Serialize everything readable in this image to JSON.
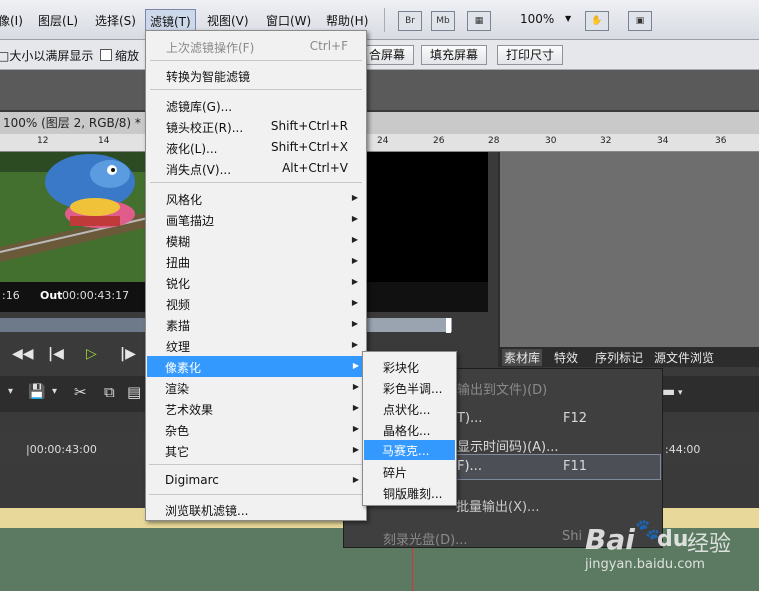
{
  "menubar": {
    "items": [
      "像(I)",
      "图层(L)",
      "选择(S)",
      "滤镜(T)",
      "视图(V)",
      "窗口(W)",
      "帮助(H)"
    ],
    "icons": [
      "Br",
      "Mb"
    ],
    "zoom": "100%"
  },
  "options": {
    "text1": "□大小以满屏显示",
    "check_label": "缩放",
    "btn_fit": "合屏幕",
    "btn_fill": "填充屏幕",
    "btn_print": "打印尺寸"
  },
  "document": {
    "tab_title": "100% (图层 2, RGB/8) *"
  },
  "ruler": {
    "ticks": [
      "12",
      "14",
      "24",
      "26",
      "28",
      "30",
      "32",
      "34",
      "36"
    ]
  },
  "monitor": {
    "tc_left": ":16",
    "out_label": "Out",
    "out_time": "00:00:43:17"
  },
  "panel": {
    "tabs": [
      "素材库",
      "特效",
      "序列标记",
      "源文件浏览"
    ]
  },
  "timeline": {
    "tc1": "|00:00:43:00",
    "tc2": ":44:00"
  },
  "filter_menu": {
    "last_filter": "上次滤镜操作(F)",
    "last_filter_sc": "Ctrl+F",
    "smart": "转换为智能滤镜",
    "gallery": "滤镜库(G)...",
    "lens": "镜头校正(R)...",
    "lens_sc": "Shift+Ctrl+R",
    "liquify": "液化(L)...",
    "liquify_sc": "Shift+Ctrl+X",
    "vanishing": "消失点(V)...",
    "vanishing_sc": "Alt+Ctrl+V",
    "groups": [
      "风格化",
      "画笔描边",
      "模糊",
      "扭曲",
      "锐化",
      "视频",
      "素描",
      "纹理",
      "像素化",
      "渲染",
      "艺术效果",
      "杂色",
      "其它"
    ],
    "digimarc": "Digimarc",
    "browse": "浏览联机滤镜..."
  },
  "pixelate_submenu": {
    "items": [
      "彩块化",
      "彩色半调...",
      "点状化...",
      "晶格化...",
      "马赛克...",
      "碎片",
      "铜版雕刻..."
    ],
    "highlighted": "马赛克..."
  },
  "export_menu": {
    "item1": "输出到文件)(D)",
    "item2": "T)...",
    "item2_sc": "F12",
    "item3": "显示时间码)(A)...",
    "item4": "F)...",
    "item4_sc": "F11",
    "item5": "批量输出(X)...",
    "item6": "刻录光盘(D)...",
    "item6_sc": "Shi"
  },
  "watermark": {
    "brand": "Bai",
    "brand2": "du",
    "cn": "经验",
    "url": "jingyan.baidu.com"
  },
  "colors": {
    "highlight": "#3399ff",
    "menu_bg": "#f1f1f1"
  }
}
